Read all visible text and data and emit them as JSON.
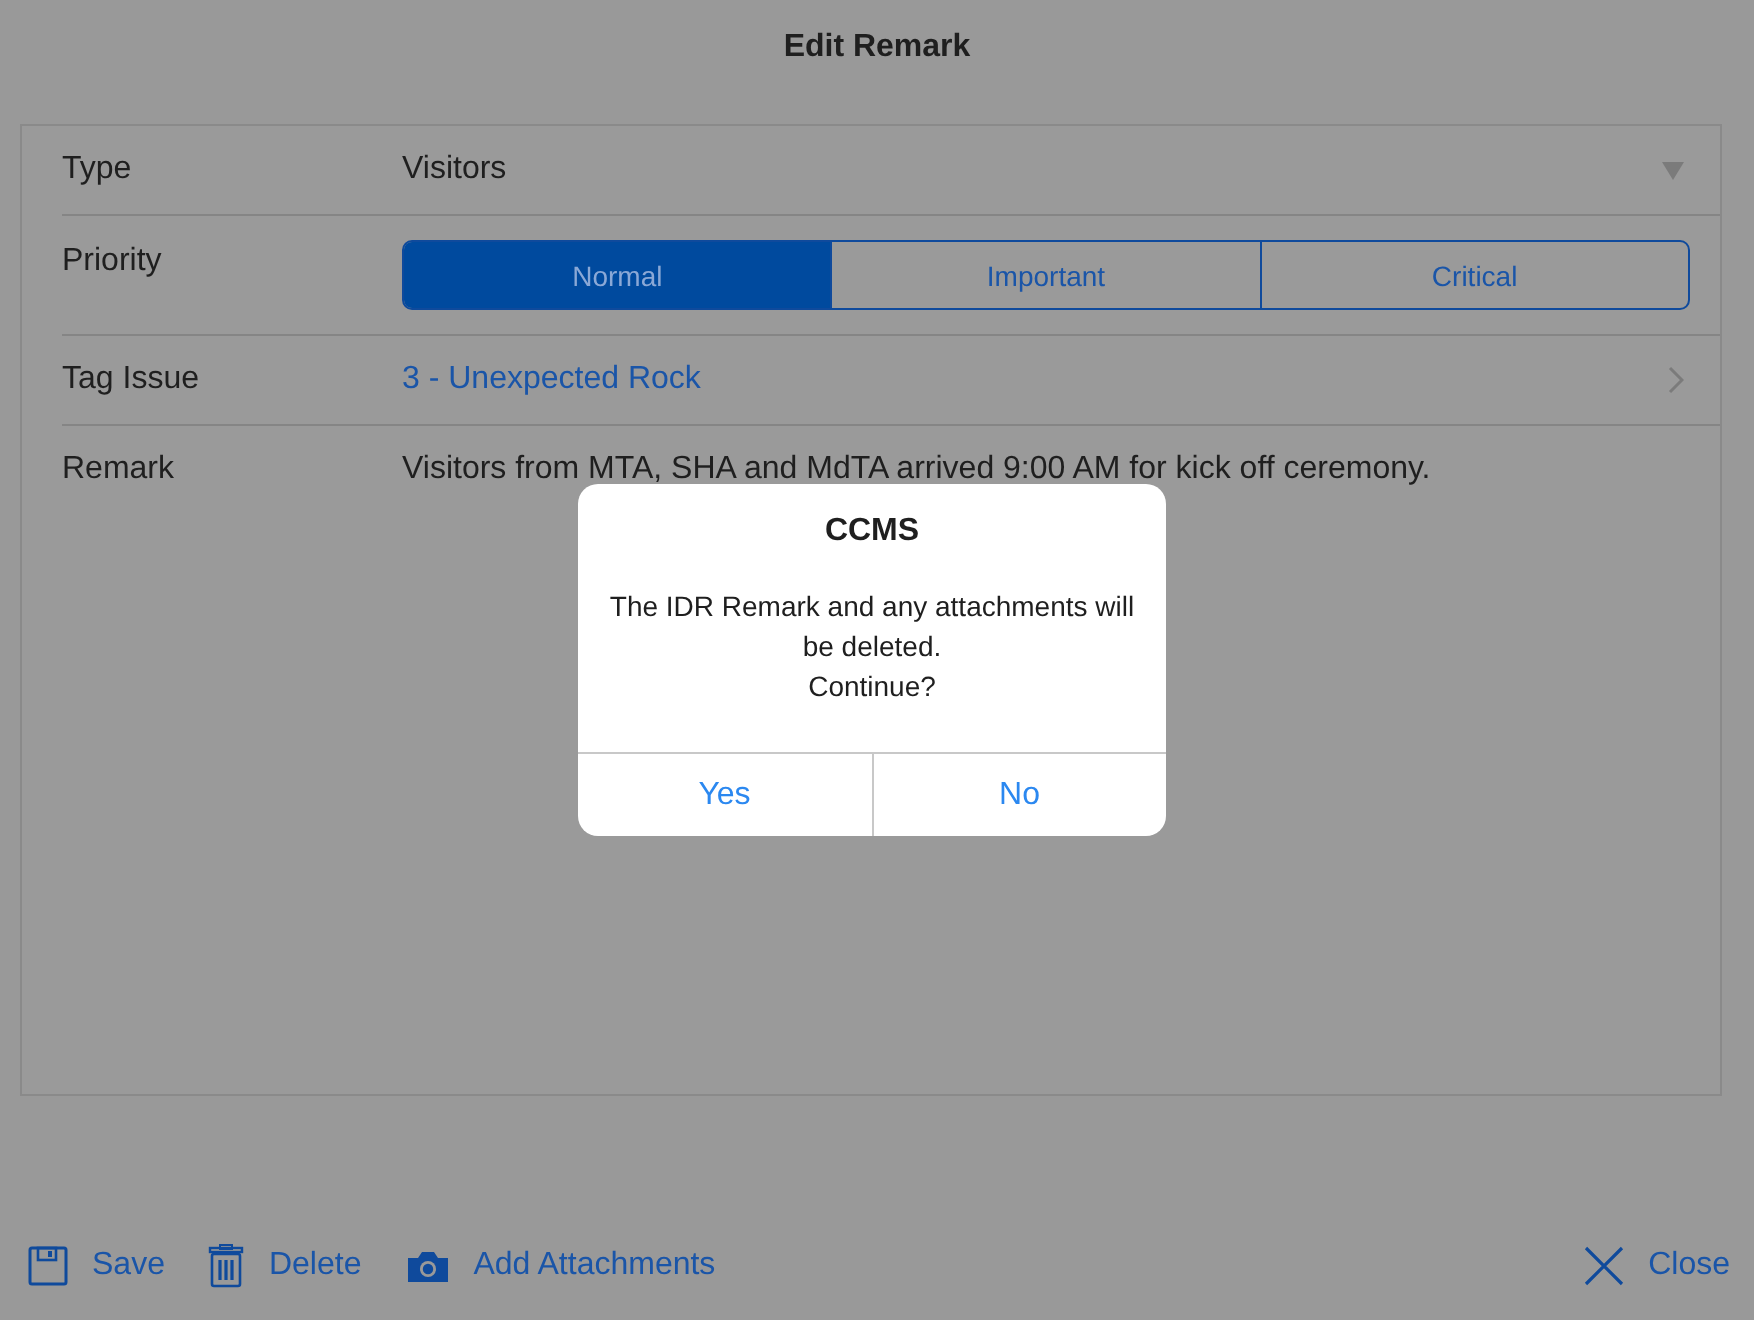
{
  "window": {
    "title": "Edit Remark"
  },
  "fields": [
    {
      "kind": "dropdown",
      "label": "Type",
      "value": "Visitors"
    },
    {
      "kind": "segmented",
      "label": "Priority",
      "options": [
        {
          "label": "Normal",
          "selected": true
        },
        {
          "label": "Important",
          "selected": false
        },
        {
          "label": "Critical",
          "selected": false
        }
      ]
    },
    {
      "kind": "link",
      "label": "Tag Issue",
      "value": "3 - Unexpected Rock"
    },
    {
      "kind": "text",
      "label": "Remark",
      "value": "Visitors from MTA, SHA and MdTA arrived 9:00 AM for kick off ceremony."
    }
  ],
  "toolbar": [
    {
      "kind": "save",
      "label": "Save"
    },
    {
      "kind": "delete",
      "label": "Delete"
    },
    {
      "kind": "camera",
      "label": "Add Attachments"
    }
  ],
  "close": {
    "label": "Close"
  },
  "alert": {
    "title": "CCMS",
    "message_lines": [
      "The IDR Remark and any attachments will",
      "be deleted.",
      "Continue?"
    ],
    "buttons": [
      "Yes",
      "No"
    ]
  }
}
